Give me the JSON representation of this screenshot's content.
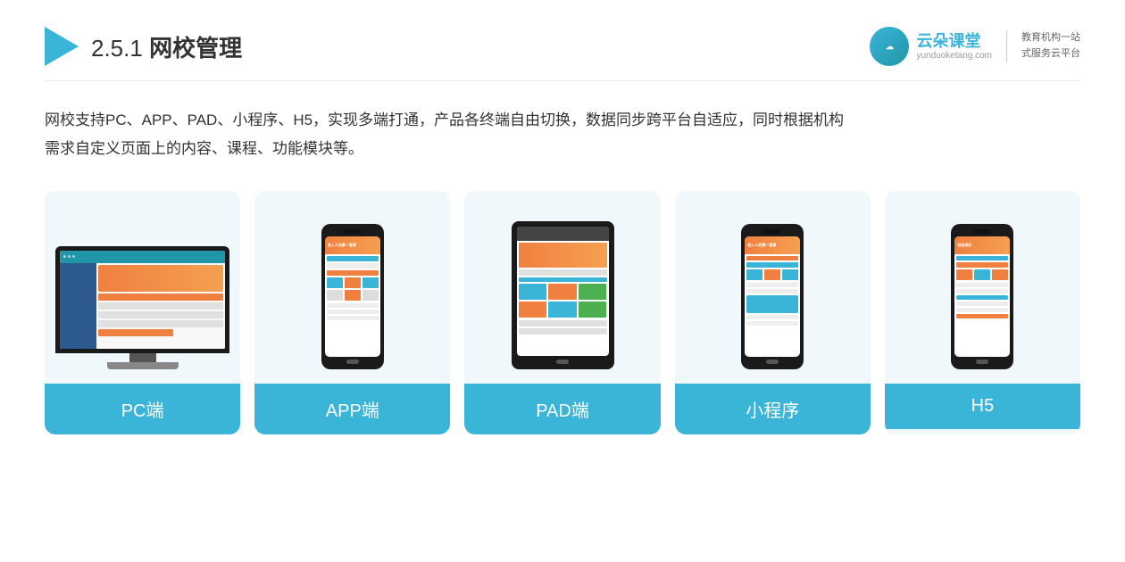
{
  "header": {
    "title_prefix": "2.5.1 ",
    "title_bold": "网校管理",
    "brand": {
      "name": "云朵课堂",
      "url": "yunduoketang.com",
      "slogan_line1": "教育机构一站",
      "slogan_line2": "式服务云平台"
    }
  },
  "description": {
    "text": "网校支持PC、APP、PAD、小程序、H5，实现多端打通，产品各终端自由切换，数据同步跨平台自适应，同时根据机构",
    "text2": "需求自定义页面上的内容、课程、功能模块等。"
  },
  "cards": [
    {
      "label": "PC端",
      "type": "pc"
    },
    {
      "label": "APP端",
      "type": "phone"
    },
    {
      "label": "PAD端",
      "type": "tablet"
    },
    {
      "label": "小程序",
      "type": "phone"
    },
    {
      "label": "H5",
      "type": "phone"
    }
  ]
}
